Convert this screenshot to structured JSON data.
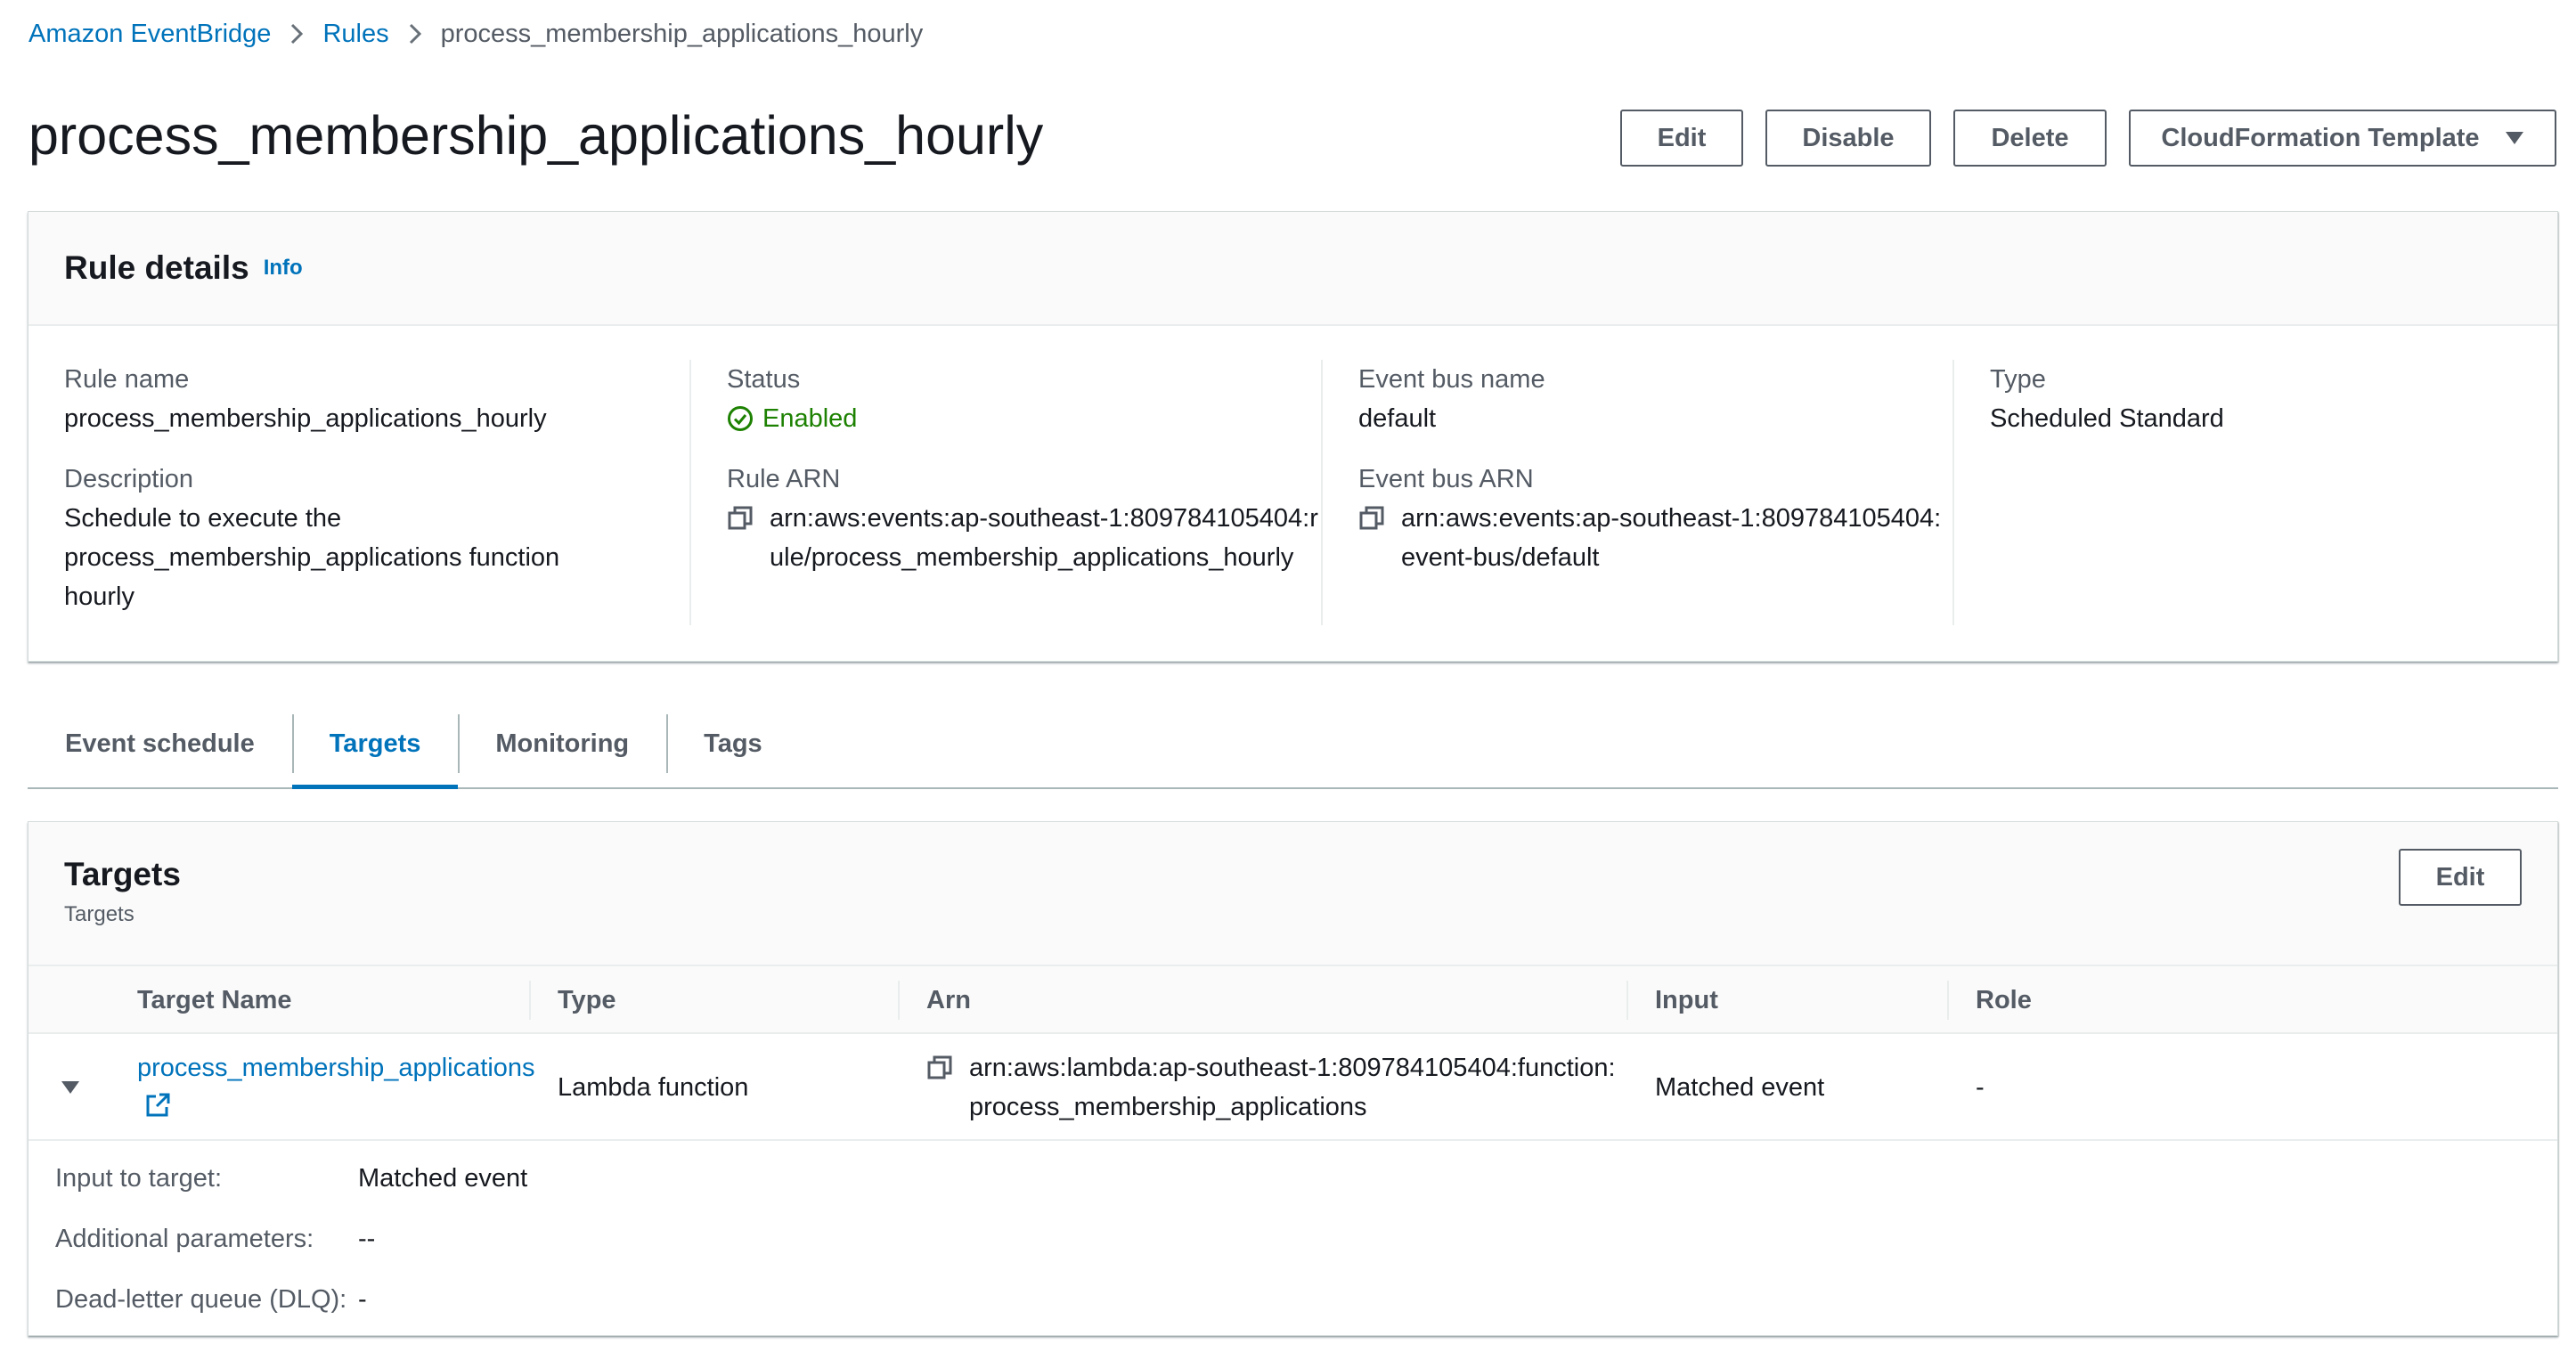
{
  "breadcrumb": {
    "items": [
      "Amazon EventBridge",
      "Rules"
    ],
    "current": "process_membership_applications_hourly"
  },
  "header": {
    "title": "process_membership_applications_hourly",
    "actions": {
      "edit": "Edit",
      "disable": "Disable",
      "delete": "Delete",
      "cloudformation": "CloudFormation Template"
    }
  },
  "rule_details": {
    "title": "Rule details",
    "info": "Info",
    "rule_name_label": "Rule name",
    "rule_name": "process_membership_applications_hourly",
    "description_label": "Description",
    "description": "Schedule to execute the process_membership_applications function hourly",
    "status_label": "Status",
    "status": "Enabled",
    "rule_arn_label": "Rule ARN",
    "rule_arn": "arn:aws:events:ap-southeast-1:809784105404:rule/process_membership_applications_hourly",
    "event_bus_name_label": "Event bus name",
    "event_bus_name": "default",
    "event_bus_arn_label": "Event bus ARN",
    "event_bus_arn": "arn:aws:events:ap-southeast-1:809784105404:event-bus/default",
    "type_label": "Type",
    "type": "Scheduled Standard"
  },
  "tabs": [
    "Event schedule",
    "Targets",
    "Monitoring",
    "Tags"
  ],
  "active_tab": "Targets",
  "targets": {
    "title": "Targets",
    "subtitle": "Targets",
    "edit": "Edit",
    "columns": [
      "Target Name",
      "Type",
      "Arn",
      "Input",
      "Role"
    ],
    "rows": [
      {
        "name": "process_membership_applications",
        "type": "Lambda function",
        "arn": "arn:aws:lambda:ap-southeast-1:809784105404:function:process_membership_applications",
        "input": "Matched event",
        "role": "-"
      }
    ],
    "expanded": {
      "input_label": "Input to target:",
      "input_value": "Matched event",
      "params_label": "Additional parameters:",
      "params_value": "--",
      "dlq_label": "Dead-letter queue (DLQ):",
      "dlq_value": "-"
    }
  },
  "colors": {
    "link": "#0073bb",
    "success": "#1d8102",
    "text": "#16191f",
    "muted": "#545b64"
  },
  "icons": [
    "chevron-right-icon",
    "caret-down-icon",
    "check-circle-icon",
    "copy-icon",
    "external-link-icon",
    "expand-caret-icon"
  ]
}
